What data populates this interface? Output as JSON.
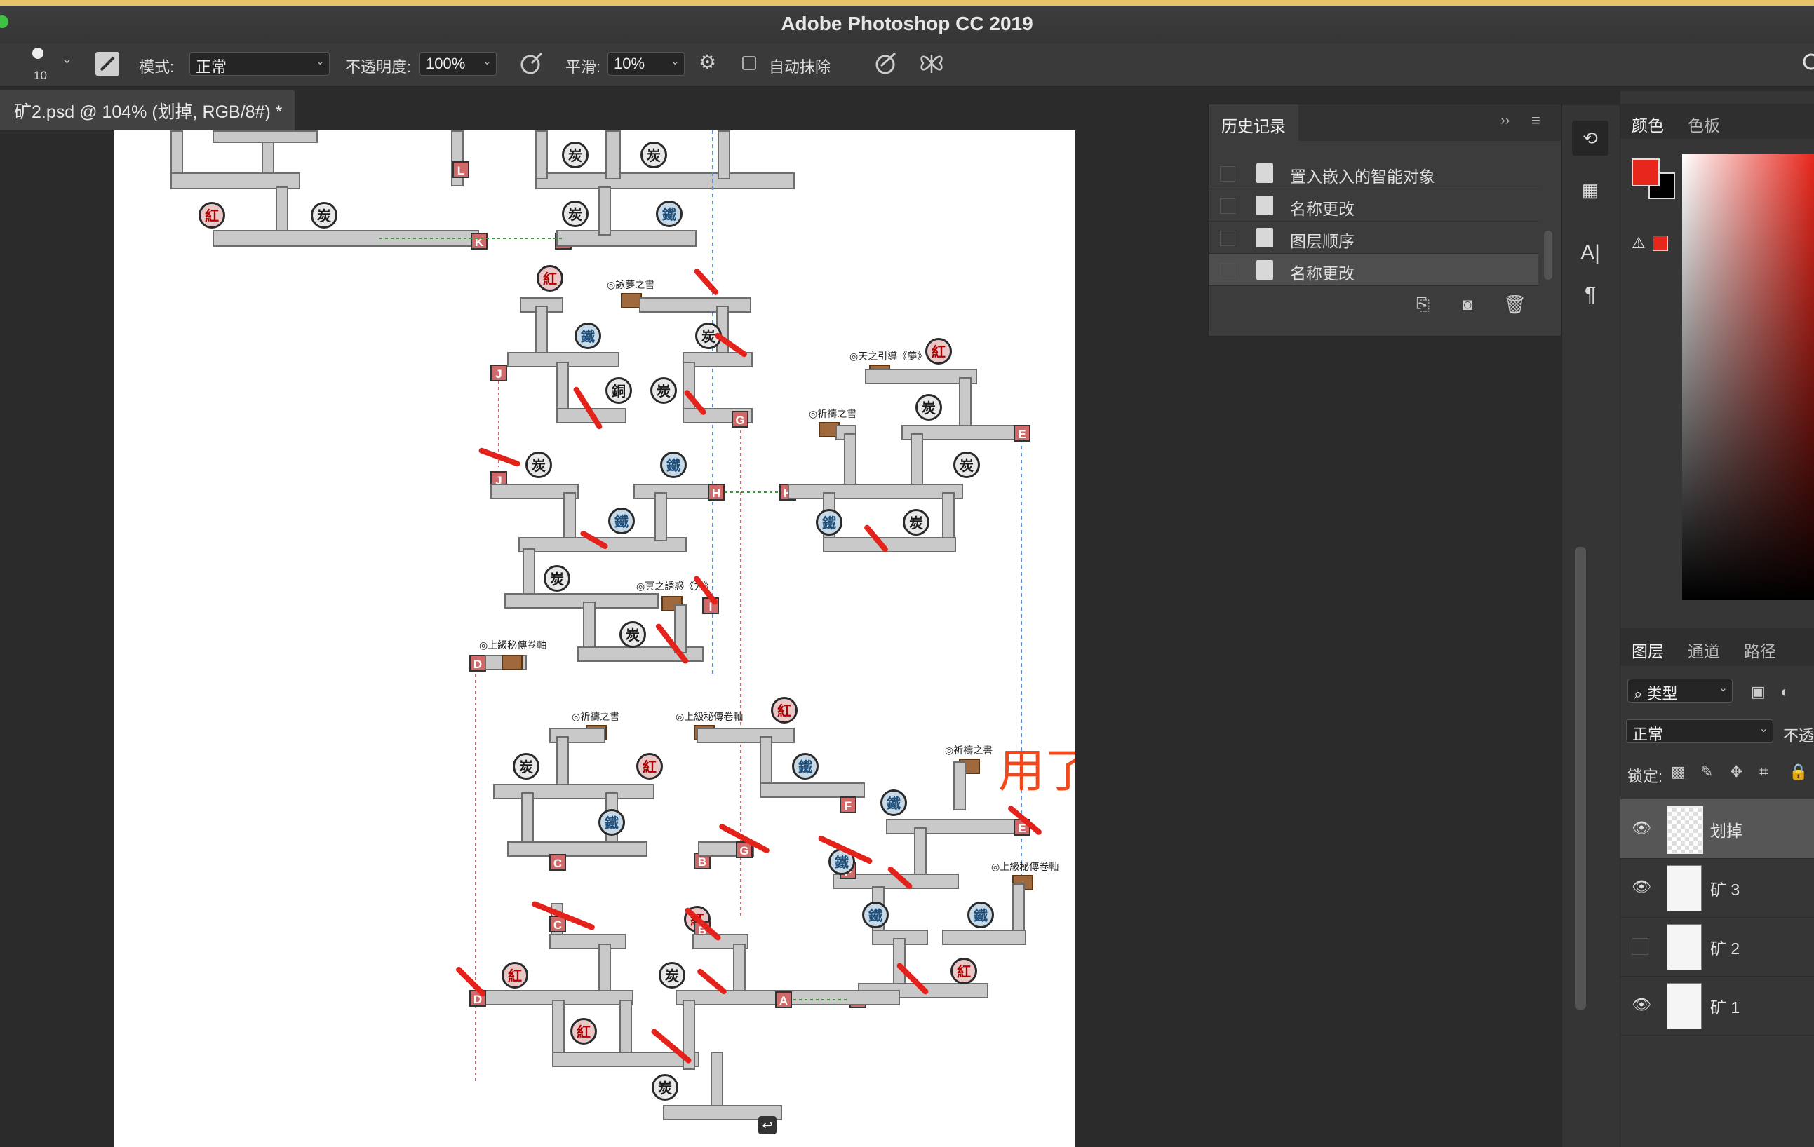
{
  "app": {
    "title": "Adobe Photoshop CC 2019"
  },
  "options": {
    "brush_size": "10",
    "mode_label": "模式:",
    "mode_value": "正常",
    "opacity_label": "不透明度:",
    "opacity_value": "100%",
    "smoothing_label": "平滑:",
    "smoothing_value": "10%",
    "auto_erase_label": "自动抹除"
  },
  "document": {
    "tab_title": "矿2.psd @ 104% (划掉, RGB/8#) *"
  },
  "canvas": {
    "annotation": "用了就划掉 即表示可走",
    "glyphs": {
      "coal": "炭",
      "iron": "鐵",
      "red": "紅",
      "copper": "銅"
    },
    "door_letters": [
      "K",
      "K",
      "L",
      "J",
      "J",
      "G",
      "H",
      "H",
      "E",
      "I",
      "D",
      "D",
      "C",
      "C",
      "B",
      "B",
      "G",
      "F",
      "F",
      "E",
      "A",
      "A"
    ],
    "labels": {
      "dream_book": "◎詠夢之書",
      "heaven_guide": "◎天之引導《夢》",
      "prayer_book": "◎祈禱之書",
      "dark_book": "◎冥之誘惑《力》",
      "upper_scroll": "◎上級秘傳卷軸"
    }
  },
  "history": {
    "title": "历史记录",
    "items": [
      "置入嵌入的智能对象",
      "名称更改",
      "图层顺序",
      "名称更改"
    ],
    "selected_index": 3
  },
  "color_panel": {
    "tabs": [
      "颜色",
      "色板"
    ],
    "foreground": "#e8271c",
    "background": "#000000"
  },
  "layers_panel": {
    "tabs": [
      "图层",
      "通道",
      "路径"
    ],
    "filter_label": "类型",
    "blend_mode": "正常",
    "opacity_label": "不透",
    "lock_label": "锁定:",
    "layers": [
      {
        "name": "划掉",
        "visible": true,
        "selected": true
      },
      {
        "name": "矿 3",
        "visible": true,
        "selected": false
      },
      {
        "name": "矿 2",
        "visible": false,
        "selected": false
      },
      {
        "name": "矿 1",
        "visible": true,
        "selected": false
      }
    ]
  }
}
